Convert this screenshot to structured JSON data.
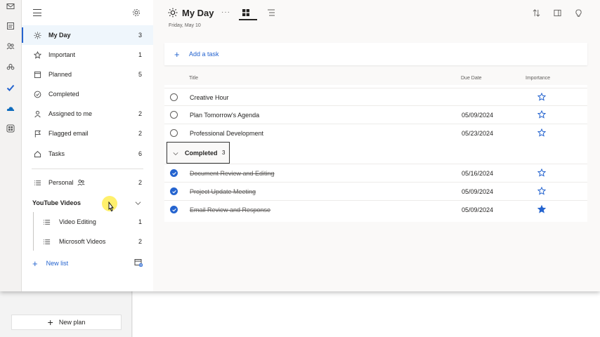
{
  "sidebar": {
    "items": [
      {
        "label": "My Day",
        "count": "3",
        "icon": "sun-icon"
      },
      {
        "label": "Important",
        "count": "1",
        "icon": "star-icon"
      },
      {
        "label": "Planned",
        "count": "5",
        "icon": "calendar-icon"
      },
      {
        "label": "Completed",
        "count": "",
        "icon": "check-circle-icon"
      },
      {
        "label": "Assigned to me",
        "count": "2",
        "icon": "person-icon"
      },
      {
        "label": "Flagged email",
        "count": "2",
        "icon": "flag-icon"
      },
      {
        "label": "Tasks",
        "count": "6",
        "icon": "home-icon"
      }
    ],
    "personal": {
      "label": "Personal",
      "count": "2"
    },
    "group": {
      "label": "YouTube Videos"
    },
    "sub_items": [
      {
        "label": "Video Editing",
        "count": "1"
      },
      {
        "label": "Microsoft Videos",
        "count": "2"
      }
    ],
    "new_list": "New list"
  },
  "header": {
    "title": "My Day",
    "date": "Friday, May 10",
    "more": "···"
  },
  "add_task": "Add a task",
  "columns": {
    "title": "Title",
    "due": "Due Date",
    "importance": "Importance"
  },
  "tasks": [
    {
      "title": "Creative Hour",
      "due": "",
      "important": false
    },
    {
      "title": "Plan Tomorrow's Agenda",
      "due": "05/09/2024",
      "important": false
    },
    {
      "title": "Professional Development",
      "due": "05/23/2024",
      "important": false
    }
  ],
  "completed": {
    "label": "Completed",
    "count": "3",
    "tasks": [
      {
        "title": "Document Review and Editing",
        "due": "05/16/2024",
        "important": false
      },
      {
        "title": "Project Update Meeting",
        "due": "05/09/2024",
        "important": false
      },
      {
        "title": "Email Review and Response",
        "due": "05/09/2024",
        "important": true
      }
    ]
  },
  "background": {
    "new_plan": "New plan"
  },
  "colors": {
    "accent": "#2564cf",
    "active_bg": "#eff6fc"
  }
}
